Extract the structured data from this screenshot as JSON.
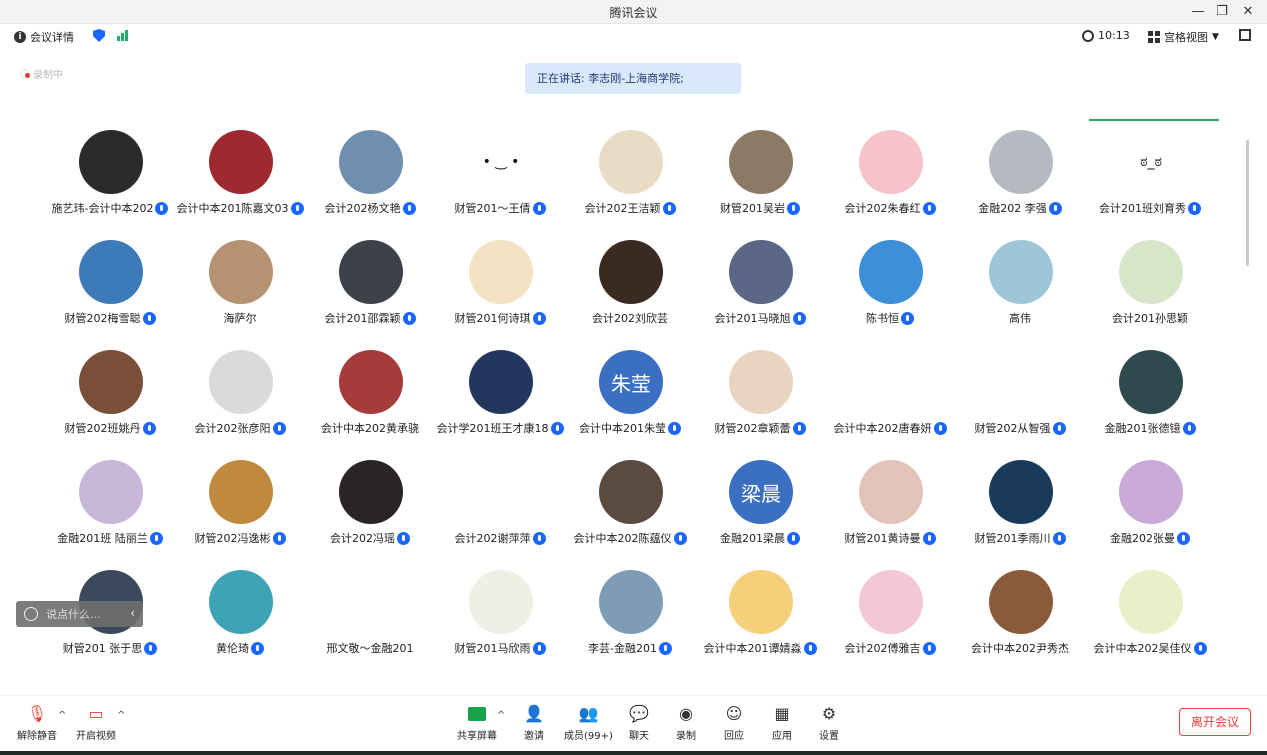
{
  "window": {
    "title": "腾讯会议",
    "min": "—",
    "restore": "❐",
    "close": "✕"
  },
  "topbar": {
    "details_label": "会议详情",
    "time": "10:13",
    "view_label": "宫格视图"
  },
  "recording_label": "录制中",
  "speaking_text": "正在讲话: 李志刚-上海商学院;",
  "chat": {
    "placeholder": "说点什么...",
    "chevron": "‹"
  },
  "colors": {
    "accent": "#1a66ff",
    "leave": "#e8423a",
    "signal": "#17b26a"
  },
  "participants": [
    {
      "name": "施艺玮-会计中本202",
      "avatar": "#2b2b2b"
    },
    {
      "name": "会计中本201陈嘉文03",
      "avatar": "#9c2a30"
    },
    {
      "name": "会计202杨文艳",
      "avatar": "#6f8fb0"
    },
    {
      "name": "财管201～王倩",
      "avatar": "#ffffff",
      "face": "• ‿ •"
    },
    {
      "name": "会计202王洁颖",
      "avatar": "#e8dcc4"
    },
    {
      "name": "财管201吴岩",
      "avatar": "#8a7a66"
    },
    {
      "name": "会计202朱春红",
      "avatar": "#f6c4c8"
    },
    {
      "name": "金融202 李强",
      "avatar": "#b5b9c2"
    },
    {
      "name": "会计201班刘育秀",
      "avatar": "#ffffff",
      "face": "ಠ_ಠ"
    },
    {
      "name": "财管202梅雪聪",
      "avatar": "#3d7ab8"
    },
    {
      "name": "海萨尔",
      "avatar": "#b59271",
      "nomic": true
    },
    {
      "name": "会计201邵霖颖",
      "avatar": "#3d4149"
    },
    {
      "name": "财管201何诗琪",
      "avatar": "#f4e3c2"
    },
    {
      "name": "会计202刘欣芸",
      "avatar": "#3a2a22",
      "nomic": true
    },
    {
      "name": "会计201马晓旭",
      "avatar": "#5b6786"
    },
    {
      "name": "陈书恒",
      "avatar": "#3e8fd8"
    },
    {
      "name": "高伟",
      "avatar": "#9fc6d8",
      "nomic": true
    },
    {
      "name": "会计201孙思颖",
      "avatar": "#d7e6c9",
      "nomic": true
    },
    {
      "name": "财管202班姚丹",
      "avatar": "#7a4f3a"
    },
    {
      "name": "会计202张彦阳",
      "avatar": "#d9dadb"
    },
    {
      "name": "会计中本202黄承骁",
      "avatar": "#a63b3b",
      "nomic": true
    },
    {
      "name": "会计学201班王才康18",
      "avatar": "#23375e"
    },
    {
      "name": "会计中本201朱莹",
      "avatar": "#3b6fc1",
      "text": "朱莹"
    },
    {
      "name": "财管202章颖蕾",
      "avatar": "#e8d4c0"
    },
    {
      "name": "会计中本202唐春妍",
      "avatar": "#ffffff"
    },
    {
      "name": "财管202从智强",
      "avatar": "#ffffff"
    },
    {
      "name": "金融201张德镱",
      "avatar": "#2f4a4f"
    },
    {
      "name": "金融201班 陆丽兰",
      "avatar": "#c9b7d9"
    },
    {
      "name": "财管202冯逸彬",
      "avatar": "#c08a3e"
    },
    {
      "name": "会计202冯瑶",
      "avatar": "#2b2424"
    },
    {
      "name": "会计202谢萍萍",
      "avatar": "#ffffff"
    },
    {
      "name": "会计中本202陈蕴仪",
      "avatar": "#5a4a40"
    },
    {
      "name": "金融201梁晨",
      "avatar": "#3b6fc1",
      "text": "梁晨"
    },
    {
      "name": "财管201黄诗曼",
      "avatar": "#e3c2b8"
    },
    {
      "name": "财管201季雨川",
      "avatar": "#1a3a5c"
    },
    {
      "name": "金融202张曼",
      "avatar": "#c9a9d8"
    },
    {
      "name": "财管201 张于思",
      "avatar": "#3a4a5c"
    },
    {
      "name": "黄伦琦",
      "avatar": "#3fa3b8"
    },
    {
      "name": "邢文敬～金融201",
      "avatar": "#ffffff",
      "nomic": true
    },
    {
      "name": "财管201马欣雨",
      "avatar": "#f0efe6"
    },
    {
      "name": "李芸-金融201",
      "avatar": "#7f9cb6"
    },
    {
      "name": "会计中本201谭婧淼",
      "avatar": "#f5cf7a"
    },
    {
      "name": "会计202傅雅吉",
      "avatar": "#f3c7d3"
    },
    {
      "name": "会计中本202尹秀杰",
      "avatar": "#8b5a3a",
      "nomic": true
    },
    {
      "name": "会计中本202吴佳仪",
      "avatar": "#e8f0c8"
    }
  ],
  "toolbar": {
    "unmute": "解除静音",
    "video": "开启视频",
    "share": "共享屏幕",
    "invite": "邀请",
    "members": "成员(99+)",
    "chat": "聊天",
    "record": "录制",
    "react": "回应",
    "apps": "应用",
    "settings": "设置",
    "leave": "离开会议"
  }
}
